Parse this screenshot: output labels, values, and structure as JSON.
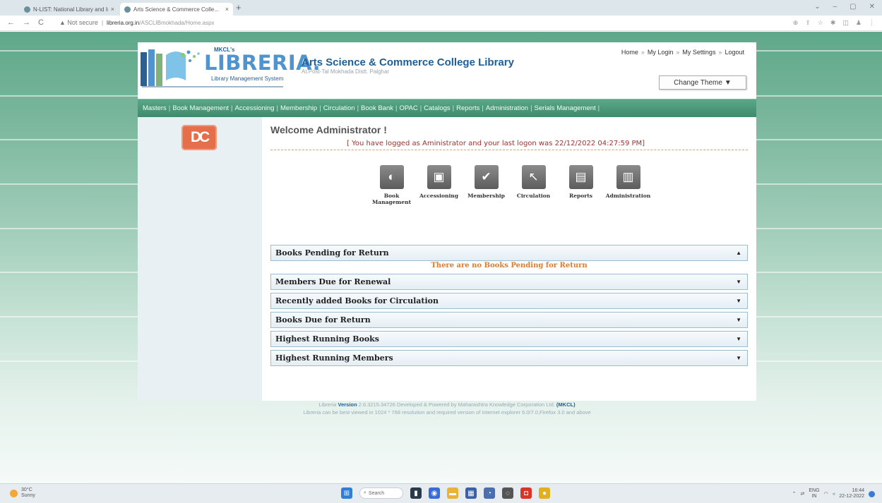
{
  "browser": {
    "tabs": [
      {
        "title": "N-LIST: National Library and Inf...",
        "close": "×"
      },
      {
        "title": "Arts Science & Commerce Colle...",
        "close": "×"
      }
    ],
    "new_tab": "+",
    "window_controls": [
      "⌄",
      "–",
      "▢",
      "✕"
    ],
    "nav": {
      "back": "←",
      "forward": "→",
      "reload": "C"
    },
    "url": {
      "warning": "▲ Not secure",
      "sep": "|",
      "domain": "libreria.org.in",
      "path": "/ASCLIBmokhada/Home.aspx"
    },
    "extension_icons": [
      "⊕",
      "⇪",
      "☆",
      "✱",
      "◫",
      "♟",
      "⋮"
    ]
  },
  "header": {
    "logo": {
      "mkcl": "MKCL's",
      "word": "LIBRERIA.",
      "sub": "Library Management System"
    },
    "college_name": "Arts Science & Commerce College Library",
    "address": "At.Post-Tal Mokhada Distt. Palghar",
    "links": [
      "Home",
      "My Login",
      "My Settings",
      "Logout"
    ],
    "link_sep": "»",
    "theme_button": "Change Theme",
    "theme_caret": "▼"
  },
  "menu": {
    "items": [
      "Masters",
      "Book Management",
      "Accessioning",
      "Membership",
      "Circulation",
      "Book Bank",
      "OPAC",
      "Catalogs",
      "Reports",
      "Administration",
      "Serials Management"
    ],
    "sep": "|"
  },
  "sidebar": {
    "icon_text": "DC"
  },
  "main": {
    "welcome": "Welcome Administrator !",
    "last_logon": "[ You have logged as Aministrator and your last logon was 22/12/2022 04:27:59 PM]",
    "quick_links": [
      {
        "label": "Book Management",
        "icon": "book-management-icon",
        "glyph": "◐"
      },
      {
        "label": "Accessioning",
        "icon": "accessioning-icon",
        "glyph": "▣"
      },
      {
        "label": "Membership",
        "icon": "membership-icon",
        "glyph": "✔"
      },
      {
        "label": "Circulation",
        "icon": "circulation-icon",
        "glyph": "↖"
      },
      {
        "label": "Reports",
        "icon": "reports-icon",
        "glyph": "▤"
      },
      {
        "label": "Administration",
        "icon": "administration-icon",
        "glyph": "▥"
      }
    ],
    "panels": [
      {
        "title": "Books Pending for Return",
        "arrow": "▲",
        "message": "There are no Books Pending for Return"
      },
      {
        "title": "Members Due for Renewal",
        "arrow": "▼"
      },
      {
        "title": "Recently added Books for Circulation",
        "arrow": "▼"
      },
      {
        "title": "Books Due for Return",
        "arrow": "▼"
      },
      {
        "title": "Highest Running Books",
        "arrow": "▼"
      },
      {
        "title": "Highest Running Members",
        "arrow": "▼"
      }
    ]
  },
  "footer": {
    "line1_prefix": "Libreria",
    "version_label": "Version",
    "version": "2.6.3215.34726",
    "line1_middle": "Developed & Powered by Maharashtra Knowledge Corporation Ltd.",
    "mkcl": "(MKCL)",
    "line2": "Libreria can be best viewed in 1024 * 768 resolution and required version of Internet explorer 6.0/7.0,Firefox 3.0 and above"
  },
  "taskbar": {
    "weather_temp": "30°C",
    "weather_desc": "Sunny",
    "search": "Search",
    "tray_lang_1": "ENG",
    "tray_lang_2": "IN",
    "time": "16:44",
    "date": "22-12-2022"
  },
  "colors": {
    "menu_green": "#4d9a7b",
    "header_blue": "#1f5e96",
    "logon_red": "#a0332f",
    "notice_orange": "#e07b2e",
    "dc_orange": "#e46f4a"
  }
}
